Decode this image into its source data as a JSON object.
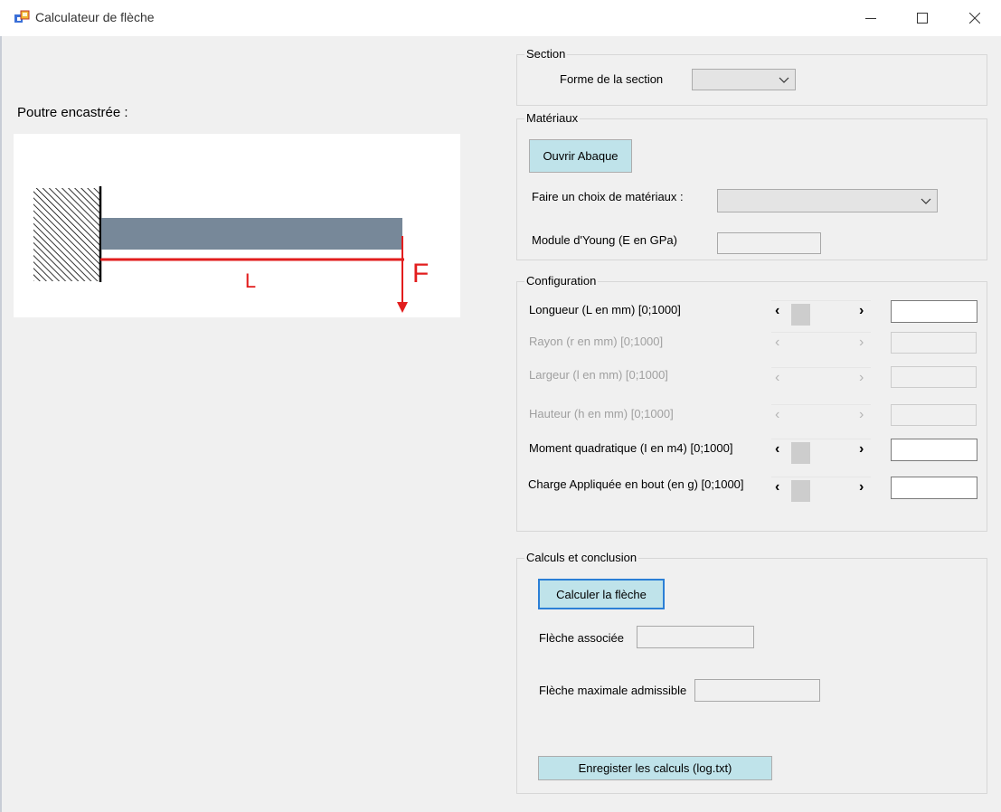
{
  "window": {
    "title": "Calculateur de flèche"
  },
  "left": {
    "heading": "Poutre encastrée  :",
    "diagram": {
      "length_label": "L",
      "force_label": "F"
    }
  },
  "section": {
    "legend": "Section",
    "shape_label": "Forme de la section",
    "shape_value": ""
  },
  "materiaux": {
    "legend": "Matériaux",
    "open_abaque": "Ouvrir Abaque",
    "choice_label": "Faire un choix de matériaux :",
    "choice_value": "",
    "young_label": "Module d'Young (E en GPa)",
    "young_value": ""
  },
  "configuration": {
    "legend": "Configuration",
    "rows": [
      {
        "label": "Longueur (L en mm)  [0;1000]",
        "value": "",
        "enabled": true
      },
      {
        "label": "Rayon (r en mm)  [0;1000]",
        "value": "",
        "enabled": false
      },
      {
        "label": "Largeur (l en mm)  [0;1000]",
        "value": "",
        "enabled": false
      },
      {
        "label": "Hauteur (h en mm)  [0;1000]",
        "value": "",
        "enabled": false
      },
      {
        "label": "Moment quadratique (I en m4)  [0;1000]",
        "value": "",
        "enabled": true
      },
      {
        "label": "Charge Appliquée en bout (en g)  [0;1000]",
        "value": "",
        "enabled": true
      }
    ]
  },
  "calculs": {
    "legend": "Calculs et conclusion",
    "compute_button": "Calculer la flèche",
    "fleche_label": "Flèche associée",
    "fleche_value": "",
    "fleche_max_label": "Flèche maximale admissible",
    "fleche_max_value": "",
    "save_button": "Enregister les calculs (log.txt)"
  },
  "colors": {
    "button_bg": "#bfe3ea",
    "beam": "#778899",
    "dimension_red": "#e21d1d",
    "focus_blue": "#2b7fd6"
  },
  "icons": [
    "app-icon",
    "minimize-icon",
    "maximize-icon",
    "close-icon",
    "chevron-down-icon",
    "chevron-left-icon",
    "chevron-right-icon"
  ]
}
